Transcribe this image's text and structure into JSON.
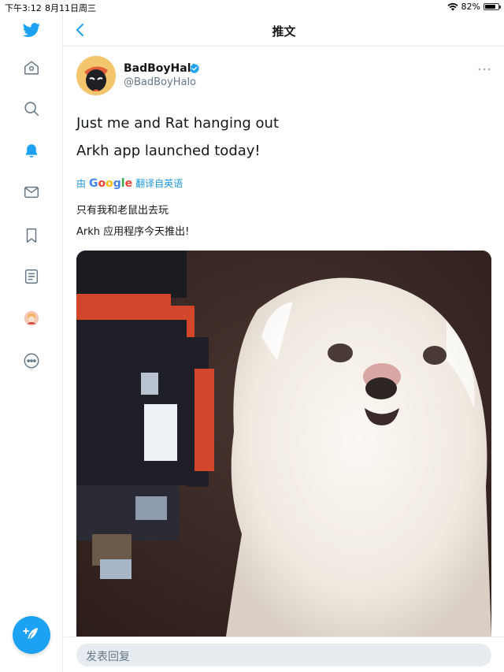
{
  "status_bar": {
    "time": "下午3:12",
    "date": "8月11日周三",
    "battery": "82%",
    "battery_level": 0.82
  },
  "header": {
    "title": "推文"
  },
  "tweet": {
    "author_name": "BadBoyHalo",
    "author_handle": "@BadBoyHalo",
    "text_line1": "Just me and Rat hanging out",
    "text_line2": "Arkh app launched today!",
    "translate_prefix": "由",
    "translate_suffix": "翻译自英语",
    "translation_line1": "只有我和老鼠出去玩",
    "translation_line2": "Arkh 应用程序今天推出!"
  },
  "reply": {
    "placeholder": "发表回复"
  },
  "icons": {
    "brand": "twitter-bird-icon",
    "sidebar": [
      "home-icon",
      "search-icon",
      "notifications-bell-icon",
      "messages-icon",
      "bookmarks-icon",
      "lists-icon",
      "profile-avatar",
      "more-options-icon"
    ],
    "compose": "compose-tweet-icon"
  },
  "colors": {
    "accent": "#1da1f2",
    "text": "#14171a",
    "secondary": "#657786",
    "border": "#e6ecf0"
  }
}
